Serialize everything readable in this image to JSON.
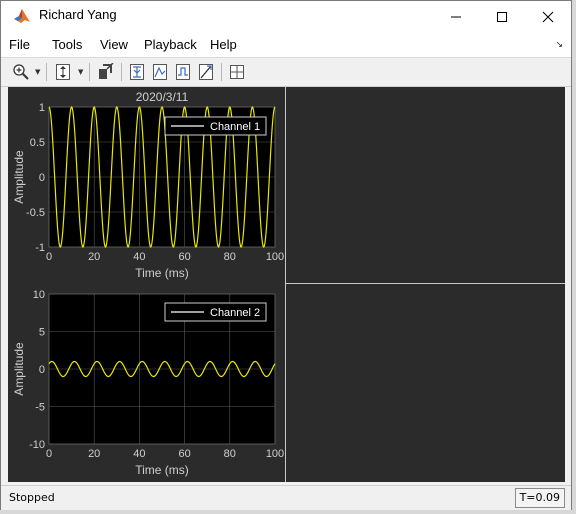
{
  "window": {
    "title": "Richard Yang"
  },
  "menu": [
    {
      "name": "menu-file",
      "label": "File"
    },
    {
      "name": "menu-tools",
      "label": "Tools"
    },
    {
      "name": "menu-view",
      "label": "View"
    },
    {
      "name": "menu-playback",
      "label": "Playback"
    },
    {
      "name": "menu-help",
      "label": "Help"
    }
  ],
  "status": {
    "text": "Stopped",
    "time": "T=0.09"
  },
  "colors": {
    "trace": "#e8e800",
    "axis_bg": "#000000",
    "figure_bg": "#2b2b2b",
    "axis_text": "#d0d0d0",
    "grid": "#5a5a5a"
  },
  "toolbar_icons": [
    "zoom-in-icon",
    "pan-icon",
    "restore-view-icon",
    "trigger-icon",
    "peak-finder-icon",
    "cursor-icon",
    "bilevel-icon",
    "layout-icon"
  ],
  "chart_data": [
    {
      "type": "line",
      "title": "2020/3/11",
      "xlabel": "Time (ms)",
      "ylabel": "Amplitude",
      "xlim": [
        0,
        100
      ],
      "ylim": [
        -1,
        1
      ],
      "xticks": [
        0,
        20,
        40,
        60,
        80,
        100
      ],
      "yticks": [
        -1,
        -0.5,
        0,
        0.5,
        1
      ],
      "yticklabels": [
        "-1",
        "-0.5",
        "0",
        "0.5",
        "1"
      ],
      "grid": true,
      "legend_position": "top-right",
      "series": [
        {
          "name": "Channel 1",
          "amplitude": 1,
          "period_ms": 10,
          "phase_deg": 90
        }
      ]
    },
    {
      "type": "line",
      "xlabel": "Time (ms)",
      "ylabel": "Amplitude",
      "xlim": [
        0,
        100
      ],
      "ylim": [
        -10,
        10
      ],
      "xticks": [
        0,
        20,
        40,
        60,
        80,
        100
      ],
      "yticks": [
        -10,
        -5,
        0,
        5,
        10
      ],
      "yticklabels": [
        "-10",
        "-5",
        "0",
        "5",
        "10"
      ],
      "grid": true,
      "legend_position": "top-right",
      "series": [
        {
          "name": "Channel 2",
          "amplitude": 1,
          "period_ms": 10,
          "phase_deg": 45
        }
      ]
    }
  ]
}
